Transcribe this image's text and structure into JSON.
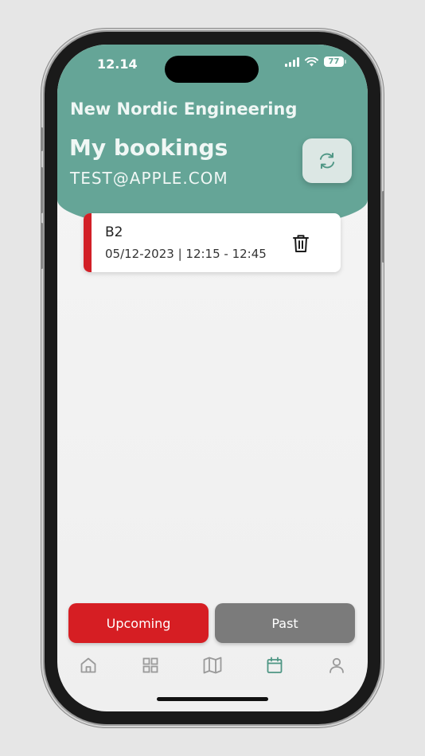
{
  "status_bar": {
    "time": "12.14",
    "battery": "77"
  },
  "header": {
    "company": "New Nordic Engineering",
    "title": "My bookings",
    "email": "TEST@APPLE.COM"
  },
  "bookings": [
    {
      "room": "B2",
      "datetime": "05/12-2023 | 12:15 - 12:45"
    }
  ],
  "tabs": {
    "upcoming_label": "Upcoming",
    "past_label": "Past"
  },
  "nav": [
    "home-icon",
    "grid-icon",
    "map-icon",
    "calendar-icon",
    "user-icon"
  ],
  "colors": {
    "header": "#65a597",
    "accent_red": "#d61e23",
    "active_nav": "#4e9684",
    "inactive_nav": "#9a9a9a",
    "past_tab": "#7b7b7b"
  }
}
